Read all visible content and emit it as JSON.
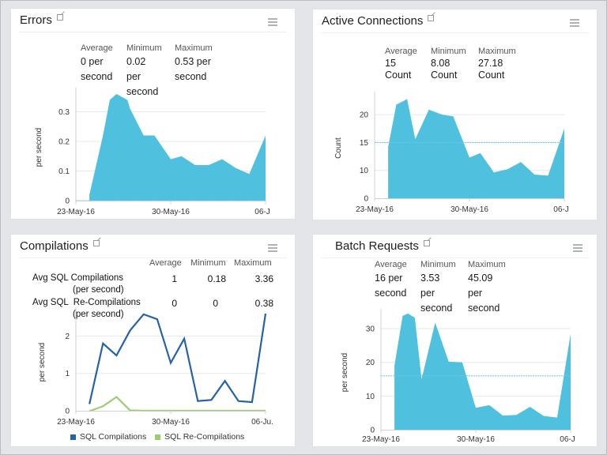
{
  "colors": {
    "area_fill": "#4fc1de",
    "avg_line": "#6fc8e6",
    "series_blue": "#2563a6",
    "series_green": "#9ccb73",
    "grid": "#e6e8ea",
    "axis": "#cfd2d5"
  },
  "panels": {
    "errors": {
      "title": "Errors",
      "stats": [
        {
          "label": "Average",
          "value_line1": "0 per",
          "value_line2": "second"
        },
        {
          "label": "Minimum",
          "value_line1": "0.02 per",
          "value_line2": "second"
        },
        {
          "label": "Maximum",
          "value_line1": "0.53 per",
          "value_line2": "second"
        }
      ]
    },
    "active_connections": {
      "title": "Active Connections",
      "stats": [
        {
          "label": "Average",
          "value_line1": "15",
          "value_line2": "Count"
        },
        {
          "label": "Minimum",
          "value_line1": "8.08",
          "value_line2": "Count"
        },
        {
          "label": "Maximum",
          "value_line1": "27.18",
          "value_line2": "Count"
        }
      ]
    },
    "compilations": {
      "title": "Compilations",
      "headers": [
        "Average",
        "Minimum",
        "Maximum"
      ],
      "rows": [
        {
          "label": "Avg SQL Compilations",
          "sub": "(per second)",
          "values": [
            "1",
            "0.18",
            "3.36"
          ]
        },
        {
          "label": "Avg SQL  Re-Compilations",
          "sub": "(per second)",
          "values": [
            "0",
            "0",
            "0.38"
          ]
        }
      ]
    },
    "batch_requests": {
      "title": "Batch Requests",
      "stats": [
        {
          "label": "Average",
          "value_line1": "16 per",
          "value_line2": "second"
        },
        {
          "label": "Minimum",
          "value_line1": "3.53 per",
          "value_line2": "second"
        },
        {
          "label": "Maximum",
          "value_line1": "45.09 per",
          "value_line2": "second"
        }
      ]
    }
  },
  "chart_data": [
    {
      "id": "errors",
      "type": "area",
      "title": "Errors",
      "xlabel": "",
      "ylabel": "per second",
      "x_ticks": [
        "23-May-16",
        "30-May-16",
        "06-J"
      ],
      "y_ticks": [
        0,
        0.1,
        0.2,
        0.3
      ],
      "ylim": [
        0,
        0.36
      ],
      "x": [
        0,
        0.5,
        1,
        1.5,
        2,
        2.5,
        3,
        3.5,
        4,
        4.5,
        5,
        5.5,
        6,
        6.5,
        7,
        7.5,
        8,
        8.5,
        9,
        9.5,
        10,
        10.5,
        11,
        11.5,
        12,
        12.5,
        13,
        13.5,
        14
      ],
      "xdomain": [
        0,
        14
      ],
      "points": [
        [
          1.0,
          0.0
        ],
        [
          1.0,
          0.02
        ],
        [
          2.0,
          0.22
        ],
        [
          2.5,
          0.34
        ],
        [
          3.0,
          0.36
        ],
        [
          3.8,
          0.34
        ],
        [
          4.0,
          0.31
        ],
        [
          5.0,
          0.22
        ],
        [
          5.8,
          0.22
        ],
        [
          7.0,
          0.14
        ],
        [
          7.8,
          0.15
        ],
        [
          8.8,
          0.12
        ],
        [
          9.8,
          0.12
        ],
        [
          10.8,
          0.14
        ],
        [
          11.8,
          0.11
        ],
        [
          12.8,
          0.09
        ],
        [
          14.0,
          0.22
        ],
        [
          14.0,
          0.0
        ]
      ],
      "avg_line": 0
    },
    {
      "id": "active_connections",
      "type": "area",
      "title": "Active Connections",
      "ylabel": "Count",
      "x_ticks": [
        "23-May-16",
        "30-May-16",
        "06-J"
      ],
      "y_ticks": [
        0,
        10,
        15,
        20
      ],
      "ylim": [
        0,
        23
      ],
      "xdomain": [
        0,
        14
      ],
      "points": [
        [
          1.0,
          0
        ],
        [
          1.0,
          14.2
        ],
        [
          1.6,
          21.8
        ],
        [
          2.4,
          22.8
        ],
        [
          3.0,
          15.6
        ],
        [
          4.0,
          20.9
        ],
        [
          5.0,
          20.0
        ],
        [
          5.8,
          19.7
        ],
        [
          7.0,
          12.3
        ],
        [
          7.8,
          13.1
        ],
        [
          8.8,
          9.3
        ],
        [
          9.8,
          10.2
        ],
        [
          10.8,
          11.5
        ],
        [
          11.8,
          8.5
        ],
        [
          12.8,
          8.1
        ],
        [
          14.0,
          17.5
        ],
        [
          14.0,
          0
        ]
      ],
      "avg_line": 15
    },
    {
      "id": "compilations",
      "type": "line",
      "title": "Compilations",
      "ylabel": "per second",
      "x_ticks": [
        "23-May-16",
        "30-May-16",
        "06-Ju."
      ],
      "y_ticks": [
        0,
        1,
        2
      ],
      "ylim": [
        0,
        2.6
      ],
      "xdomain": [
        0,
        14
      ],
      "series": [
        {
          "name": "SQL Compilations",
          "points": [
            [
              1,
              0.18
            ],
            [
              2,
              1.8
            ],
            [
              3,
              1.48
            ],
            [
              4,
              2.15
            ],
            [
              5,
              2.58
            ],
            [
              6,
              2.45
            ],
            [
              7,
              1.28
            ],
            [
              8,
              1.93
            ],
            [
              9,
              0.26
            ],
            [
              10,
              0.29
            ],
            [
              11,
              0.8
            ],
            [
              12,
              0.26
            ],
            [
              13,
              0.23
            ],
            [
              14,
              2.6
            ]
          ]
        },
        {
          "name": "SQL Re-Compilations",
          "points": [
            [
              1,
              -0.01
            ],
            [
              2,
              0.12
            ],
            [
              3,
              0.37
            ],
            [
              4,
              0.01
            ],
            [
              5,
              0.0
            ],
            [
              6,
              0.0
            ],
            [
              7,
              0.0
            ],
            [
              8,
              0.0
            ],
            [
              9,
              0.0
            ],
            [
              10,
              0.0
            ],
            [
              11,
              0.0
            ],
            [
              12,
              0.0
            ],
            [
              13,
              0.0
            ],
            [
              14,
              0.0
            ]
          ]
        }
      ],
      "legend": [
        "SQL Compilations",
        "SQL Re-Compilations"
      ],
      "legend_position": "bottom"
    },
    {
      "id": "batch_requests",
      "type": "area",
      "title": "Batch Requests",
      "ylabel": "per second",
      "x_ticks": [
        "23-May-16",
        "30-May-16",
        "06-J"
      ],
      "y_ticks": [
        0,
        10,
        20,
        30
      ],
      "ylim": [
        0,
        34
      ],
      "xdomain": [
        0,
        14
      ],
      "points": [
        [
          1.0,
          0
        ],
        [
          1.0,
          19
        ],
        [
          1.6,
          33.8
        ],
        [
          2.0,
          34.5
        ],
        [
          2.5,
          33.2
        ],
        [
          3.0,
          15
        ],
        [
          4.0,
          31.8
        ],
        [
          5.0,
          20.2
        ],
        [
          6.0,
          20.0
        ],
        [
          7.0,
          6.5
        ],
        [
          8.0,
          7.3
        ],
        [
          9.0,
          4.2
        ],
        [
          10.0,
          4.4
        ],
        [
          11.0,
          6.8
        ],
        [
          12.0,
          4.1
        ],
        [
          13.0,
          3.6
        ],
        [
          14.0,
          28.5
        ],
        [
          14.0,
          0
        ]
      ],
      "avg_line": 16
    }
  ]
}
